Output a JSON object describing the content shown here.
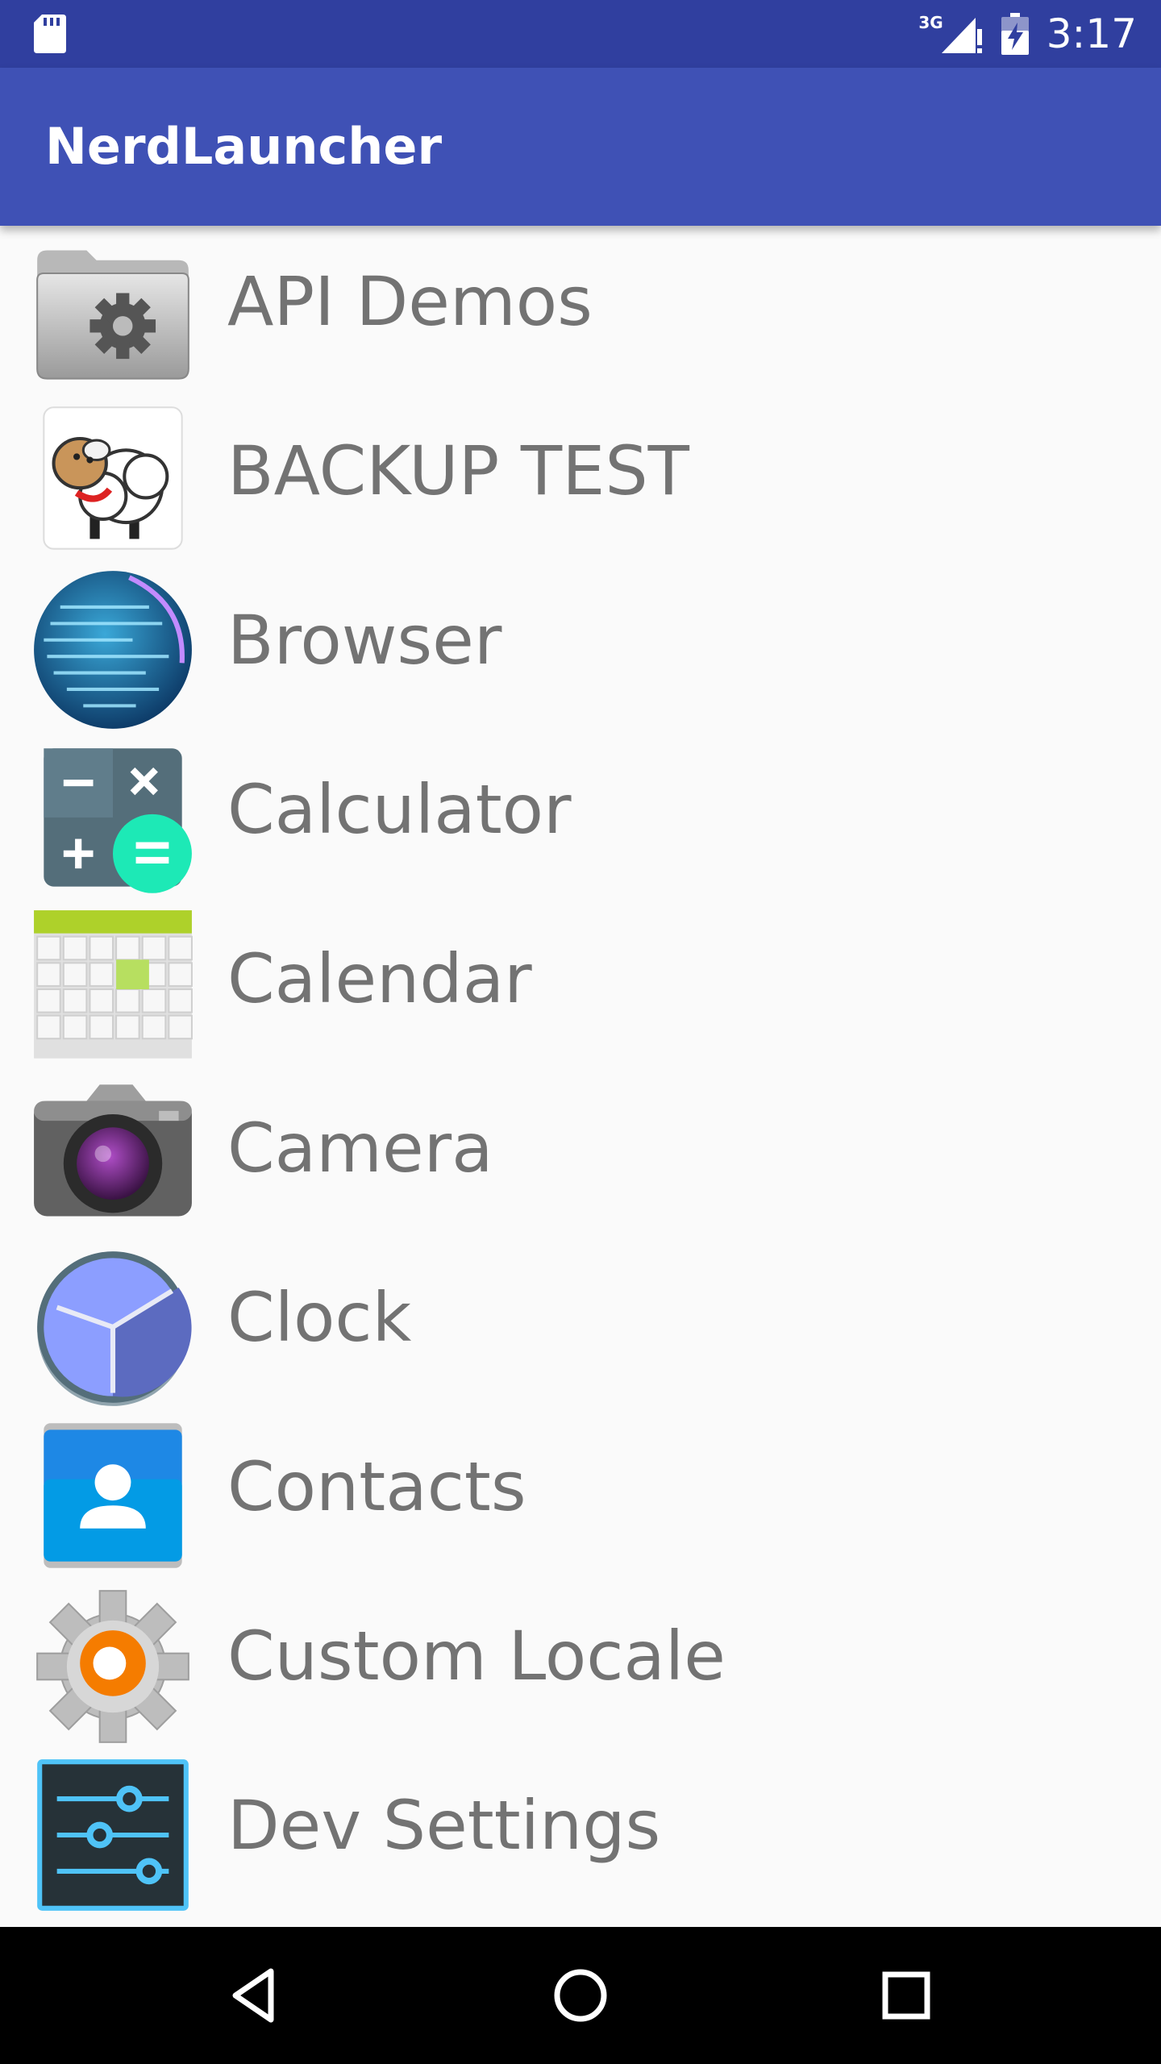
{
  "status_bar": {
    "network_label": "3G",
    "time": "3:17",
    "icons": [
      "sd-card-icon",
      "signal-icon",
      "battery-charging-icon"
    ]
  },
  "app_bar": {
    "title": "NerdLauncher"
  },
  "apps": [
    {
      "label": "API Demos",
      "icon": "folder-gear-icon"
    },
    {
      "label": "BACKUP TEST",
      "icon": "sheep-icon"
    },
    {
      "label": "Browser",
      "icon": "globe-icon"
    },
    {
      "label": "Calculator",
      "icon": "calculator-icon"
    },
    {
      "label": "Calendar",
      "icon": "calendar-icon"
    },
    {
      "label": "Camera",
      "icon": "camera-icon"
    },
    {
      "label": "Clock",
      "icon": "clock-icon"
    },
    {
      "label": "Contacts",
      "icon": "contacts-icon"
    },
    {
      "label": "Custom Locale",
      "icon": "locale-gear-icon"
    },
    {
      "label": "Dev Settings",
      "icon": "settings-sliders-icon"
    }
  ],
  "nav_bar": {
    "icons": [
      "back-icon",
      "home-icon",
      "recents-icon"
    ]
  },
  "colors": {
    "status_bar": "#303f9f",
    "app_bar": "#3f51b5",
    "background": "#fafafa",
    "label_text": "#737373",
    "nav_bar": "#000000"
  }
}
